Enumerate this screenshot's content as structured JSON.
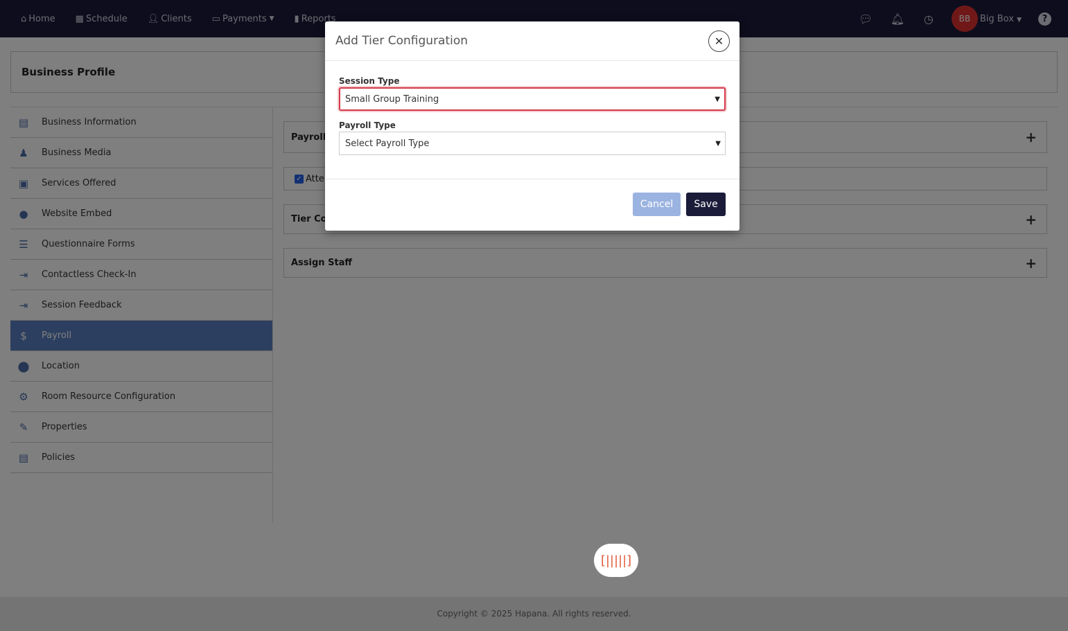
{
  "nav": {
    "items": [
      {
        "label": "Home",
        "icon": "home-icon"
      },
      {
        "label": "Schedule",
        "icon": "calendar-icon"
      },
      {
        "label": "Clients",
        "icon": "user-icon"
      },
      {
        "label": "Payments",
        "icon": "credit-card-icon"
      },
      {
        "label": "Reports",
        "icon": "bar-chart-icon"
      }
    ],
    "avatar_initials": "BB",
    "user_name": "Big Box"
  },
  "page": {
    "title": "Business Profile"
  },
  "sidebar": {
    "items": [
      {
        "label": "Business Information",
        "icon": "id-card-icon"
      },
      {
        "label": "Business Media",
        "icon": "user-media-icon"
      },
      {
        "label": "Services Offered",
        "icon": "services-icon"
      },
      {
        "label": "Website Embed",
        "icon": "globe-icon"
      },
      {
        "label": "Questionnaire Forms",
        "icon": "list-icon"
      },
      {
        "label": "Contactless Check-In",
        "icon": "sign-in-icon"
      },
      {
        "label": "Session Feedback",
        "icon": "sign-in-icon"
      },
      {
        "label": "Payroll",
        "icon": "dollar-icon"
      },
      {
        "label": "Location",
        "icon": "map-pin-icon"
      },
      {
        "label": "Room Resource Configuration",
        "icon": "gear-icon"
      },
      {
        "label": "Properties",
        "icon": "edit-icon"
      },
      {
        "label": "Policies",
        "icon": "document-icon"
      }
    ],
    "active_index": 7
  },
  "panels": {
    "payroll_label": "Payroll",
    "attendance_label": "Atte",
    "tier_label": "Tier Co",
    "assign_staff_label": "Assign Staff"
  },
  "modal": {
    "title": "Add Tier Configuration",
    "session_type_label": "Session Type",
    "session_type_value": "Small Group Training",
    "payroll_type_label": "Payroll Type",
    "payroll_type_value": "Select Payroll Type",
    "cancel_label": "Cancel",
    "save_label": "Save"
  },
  "footer": {
    "copyright": "Copyright © 2025 Hapana. All rights reserved."
  },
  "colors": {
    "nav_bg": "#1b1b3a",
    "active_sidebar": "#5b7fc1",
    "avatar": "#e03131",
    "focus_ring": "#d33a4a",
    "save_button": "#1b1b3a",
    "cancel_button": "#9bb3e0"
  }
}
